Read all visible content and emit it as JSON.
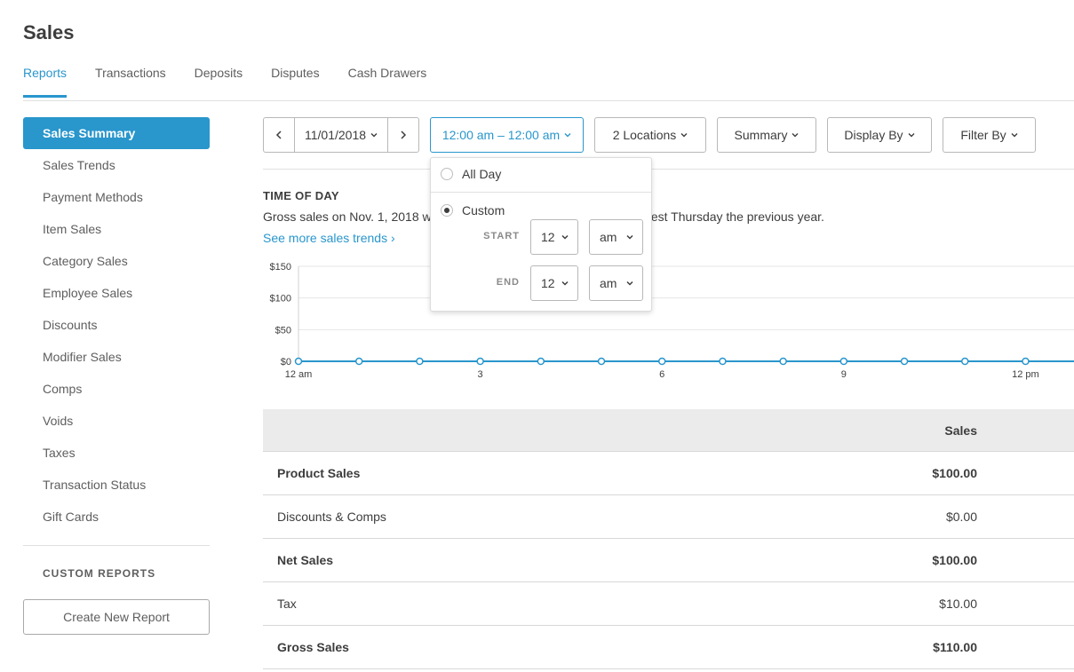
{
  "page": {
    "title": "Sales"
  },
  "tabs": [
    {
      "label": "Reports",
      "active": true
    },
    {
      "label": "Transactions"
    },
    {
      "label": "Deposits"
    },
    {
      "label": "Disputes"
    },
    {
      "label": "Cash Drawers"
    }
  ],
  "sidebar": {
    "items": [
      {
        "label": "Sales Summary",
        "active": true
      },
      {
        "label": "Sales Trends"
      },
      {
        "label": "Payment Methods"
      },
      {
        "label": "Item Sales"
      },
      {
        "label": "Category Sales"
      },
      {
        "label": "Employee Sales"
      },
      {
        "label": "Discounts"
      },
      {
        "label": "Modifier Sales"
      },
      {
        "label": "Comps"
      },
      {
        "label": "Voids"
      },
      {
        "label": "Taxes"
      },
      {
        "label": "Transaction Status"
      },
      {
        "label": "Gift Cards"
      }
    ],
    "custom_reports_label": "CUSTOM REPORTS",
    "create_button": "Create New Report"
  },
  "toolbar": {
    "prev_icon": "chevron-left-icon",
    "date": "11/01/2018",
    "next_icon": "chevron-right-icon",
    "time_range": "12:00 am – 12:00 am",
    "locations": "2 Locations",
    "summary": "Summary",
    "display_by": "Display By",
    "filter_by": "Filter By"
  },
  "time_dropdown": {
    "all_day": "All Day",
    "custom": "Custom",
    "selected": "Custom",
    "start_label": "START",
    "start_hour": "12",
    "start_period": "am",
    "end_label": "END",
    "end_hour": "12",
    "end_period": "am"
  },
  "section": {
    "title": "TIME OF DAY",
    "desc_left": "Gross sales on Nov. 1, 2018 w",
    "desc_right": "the closest Thursday the previous year.",
    "link": "See more sales trends ›"
  },
  "chart_data": {
    "type": "line",
    "y_ticks": [
      "$150",
      "$100",
      "$50",
      "$0"
    ],
    "ylim": [
      0,
      150
    ],
    "x_tick_labels": [
      "12 am",
      "3",
      "6",
      "9",
      "12 pm"
    ],
    "x_tick_hours": [
      0,
      3,
      6,
      9,
      12
    ],
    "x_range": [
      0,
      12.8
    ],
    "series": [
      {
        "x": [
          0,
          1,
          2,
          3,
          4,
          5,
          6,
          7,
          8,
          9,
          10,
          11,
          12
        ],
        "values": [
          0,
          0,
          0,
          0,
          0,
          0,
          0,
          0,
          0,
          0,
          0,
          0,
          0
        ]
      }
    ],
    "color": "#2996cc",
    "grid": true
  },
  "table": {
    "header": "Sales",
    "rows": [
      {
        "label": "Product Sales",
        "value": "$100.00",
        "bold": true
      },
      {
        "label": "Discounts & Comps",
        "value": "$0.00",
        "bold": false
      },
      {
        "label": "Net Sales",
        "value": "$100.00",
        "bold": true
      },
      {
        "label": "Tax",
        "value": "$10.00",
        "bold": false
      },
      {
        "label": "Gross Sales",
        "value": "$110.00",
        "bold": true
      }
    ]
  }
}
